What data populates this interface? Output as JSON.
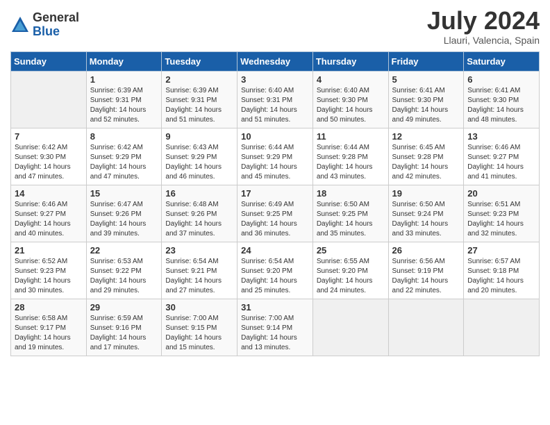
{
  "header": {
    "logo": {
      "general": "General",
      "blue": "Blue"
    },
    "title": "July 2024",
    "location": "Llauri, Valencia, Spain"
  },
  "calendar": {
    "weekdays": [
      "Sunday",
      "Monday",
      "Tuesday",
      "Wednesday",
      "Thursday",
      "Friday",
      "Saturday"
    ],
    "weeks": [
      [
        {
          "day": "",
          "info": ""
        },
        {
          "day": "1",
          "info": "Sunrise: 6:39 AM\nSunset: 9:31 PM\nDaylight: 14 hours\nand 52 minutes."
        },
        {
          "day": "2",
          "info": "Sunrise: 6:39 AM\nSunset: 9:31 PM\nDaylight: 14 hours\nand 51 minutes."
        },
        {
          "day": "3",
          "info": "Sunrise: 6:40 AM\nSunset: 9:31 PM\nDaylight: 14 hours\nand 51 minutes."
        },
        {
          "day": "4",
          "info": "Sunrise: 6:40 AM\nSunset: 9:30 PM\nDaylight: 14 hours\nand 50 minutes."
        },
        {
          "day": "5",
          "info": "Sunrise: 6:41 AM\nSunset: 9:30 PM\nDaylight: 14 hours\nand 49 minutes."
        },
        {
          "day": "6",
          "info": "Sunrise: 6:41 AM\nSunset: 9:30 PM\nDaylight: 14 hours\nand 48 minutes."
        }
      ],
      [
        {
          "day": "7",
          "info": "Sunrise: 6:42 AM\nSunset: 9:30 PM\nDaylight: 14 hours\nand 47 minutes."
        },
        {
          "day": "8",
          "info": "Sunrise: 6:42 AM\nSunset: 9:29 PM\nDaylight: 14 hours\nand 47 minutes."
        },
        {
          "day": "9",
          "info": "Sunrise: 6:43 AM\nSunset: 9:29 PM\nDaylight: 14 hours\nand 46 minutes."
        },
        {
          "day": "10",
          "info": "Sunrise: 6:44 AM\nSunset: 9:29 PM\nDaylight: 14 hours\nand 45 minutes."
        },
        {
          "day": "11",
          "info": "Sunrise: 6:44 AM\nSunset: 9:28 PM\nDaylight: 14 hours\nand 43 minutes."
        },
        {
          "day": "12",
          "info": "Sunrise: 6:45 AM\nSunset: 9:28 PM\nDaylight: 14 hours\nand 42 minutes."
        },
        {
          "day": "13",
          "info": "Sunrise: 6:46 AM\nSunset: 9:27 PM\nDaylight: 14 hours\nand 41 minutes."
        }
      ],
      [
        {
          "day": "14",
          "info": "Sunrise: 6:46 AM\nSunset: 9:27 PM\nDaylight: 14 hours\nand 40 minutes."
        },
        {
          "day": "15",
          "info": "Sunrise: 6:47 AM\nSunset: 9:26 PM\nDaylight: 14 hours\nand 39 minutes."
        },
        {
          "day": "16",
          "info": "Sunrise: 6:48 AM\nSunset: 9:26 PM\nDaylight: 14 hours\nand 37 minutes."
        },
        {
          "day": "17",
          "info": "Sunrise: 6:49 AM\nSunset: 9:25 PM\nDaylight: 14 hours\nand 36 minutes."
        },
        {
          "day": "18",
          "info": "Sunrise: 6:50 AM\nSunset: 9:25 PM\nDaylight: 14 hours\nand 35 minutes."
        },
        {
          "day": "19",
          "info": "Sunrise: 6:50 AM\nSunset: 9:24 PM\nDaylight: 14 hours\nand 33 minutes."
        },
        {
          "day": "20",
          "info": "Sunrise: 6:51 AM\nSunset: 9:23 PM\nDaylight: 14 hours\nand 32 minutes."
        }
      ],
      [
        {
          "day": "21",
          "info": "Sunrise: 6:52 AM\nSunset: 9:23 PM\nDaylight: 14 hours\nand 30 minutes."
        },
        {
          "day": "22",
          "info": "Sunrise: 6:53 AM\nSunset: 9:22 PM\nDaylight: 14 hours\nand 29 minutes."
        },
        {
          "day": "23",
          "info": "Sunrise: 6:54 AM\nSunset: 9:21 PM\nDaylight: 14 hours\nand 27 minutes."
        },
        {
          "day": "24",
          "info": "Sunrise: 6:54 AM\nSunset: 9:20 PM\nDaylight: 14 hours\nand 25 minutes."
        },
        {
          "day": "25",
          "info": "Sunrise: 6:55 AM\nSunset: 9:20 PM\nDaylight: 14 hours\nand 24 minutes."
        },
        {
          "day": "26",
          "info": "Sunrise: 6:56 AM\nSunset: 9:19 PM\nDaylight: 14 hours\nand 22 minutes."
        },
        {
          "day": "27",
          "info": "Sunrise: 6:57 AM\nSunset: 9:18 PM\nDaylight: 14 hours\nand 20 minutes."
        }
      ],
      [
        {
          "day": "28",
          "info": "Sunrise: 6:58 AM\nSunset: 9:17 PM\nDaylight: 14 hours\nand 19 minutes."
        },
        {
          "day": "29",
          "info": "Sunrise: 6:59 AM\nSunset: 9:16 PM\nDaylight: 14 hours\nand 17 minutes."
        },
        {
          "day": "30",
          "info": "Sunrise: 7:00 AM\nSunset: 9:15 PM\nDaylight: 14 hours\nand 15 minutes."
        },
        {
          "day": "31",
          "info": "Sunrise: 7:00 AM\nSunset: 9:14 PM\nDaylight: 14 hours\nand 13 minutes."
        },
        {
          "day": "",
          "info": ""
        },
        {
          "day": "",
          "info": ""
        },
        {
          "day": "",
          "info": ""
        }
      ]
    ]
  }
}
